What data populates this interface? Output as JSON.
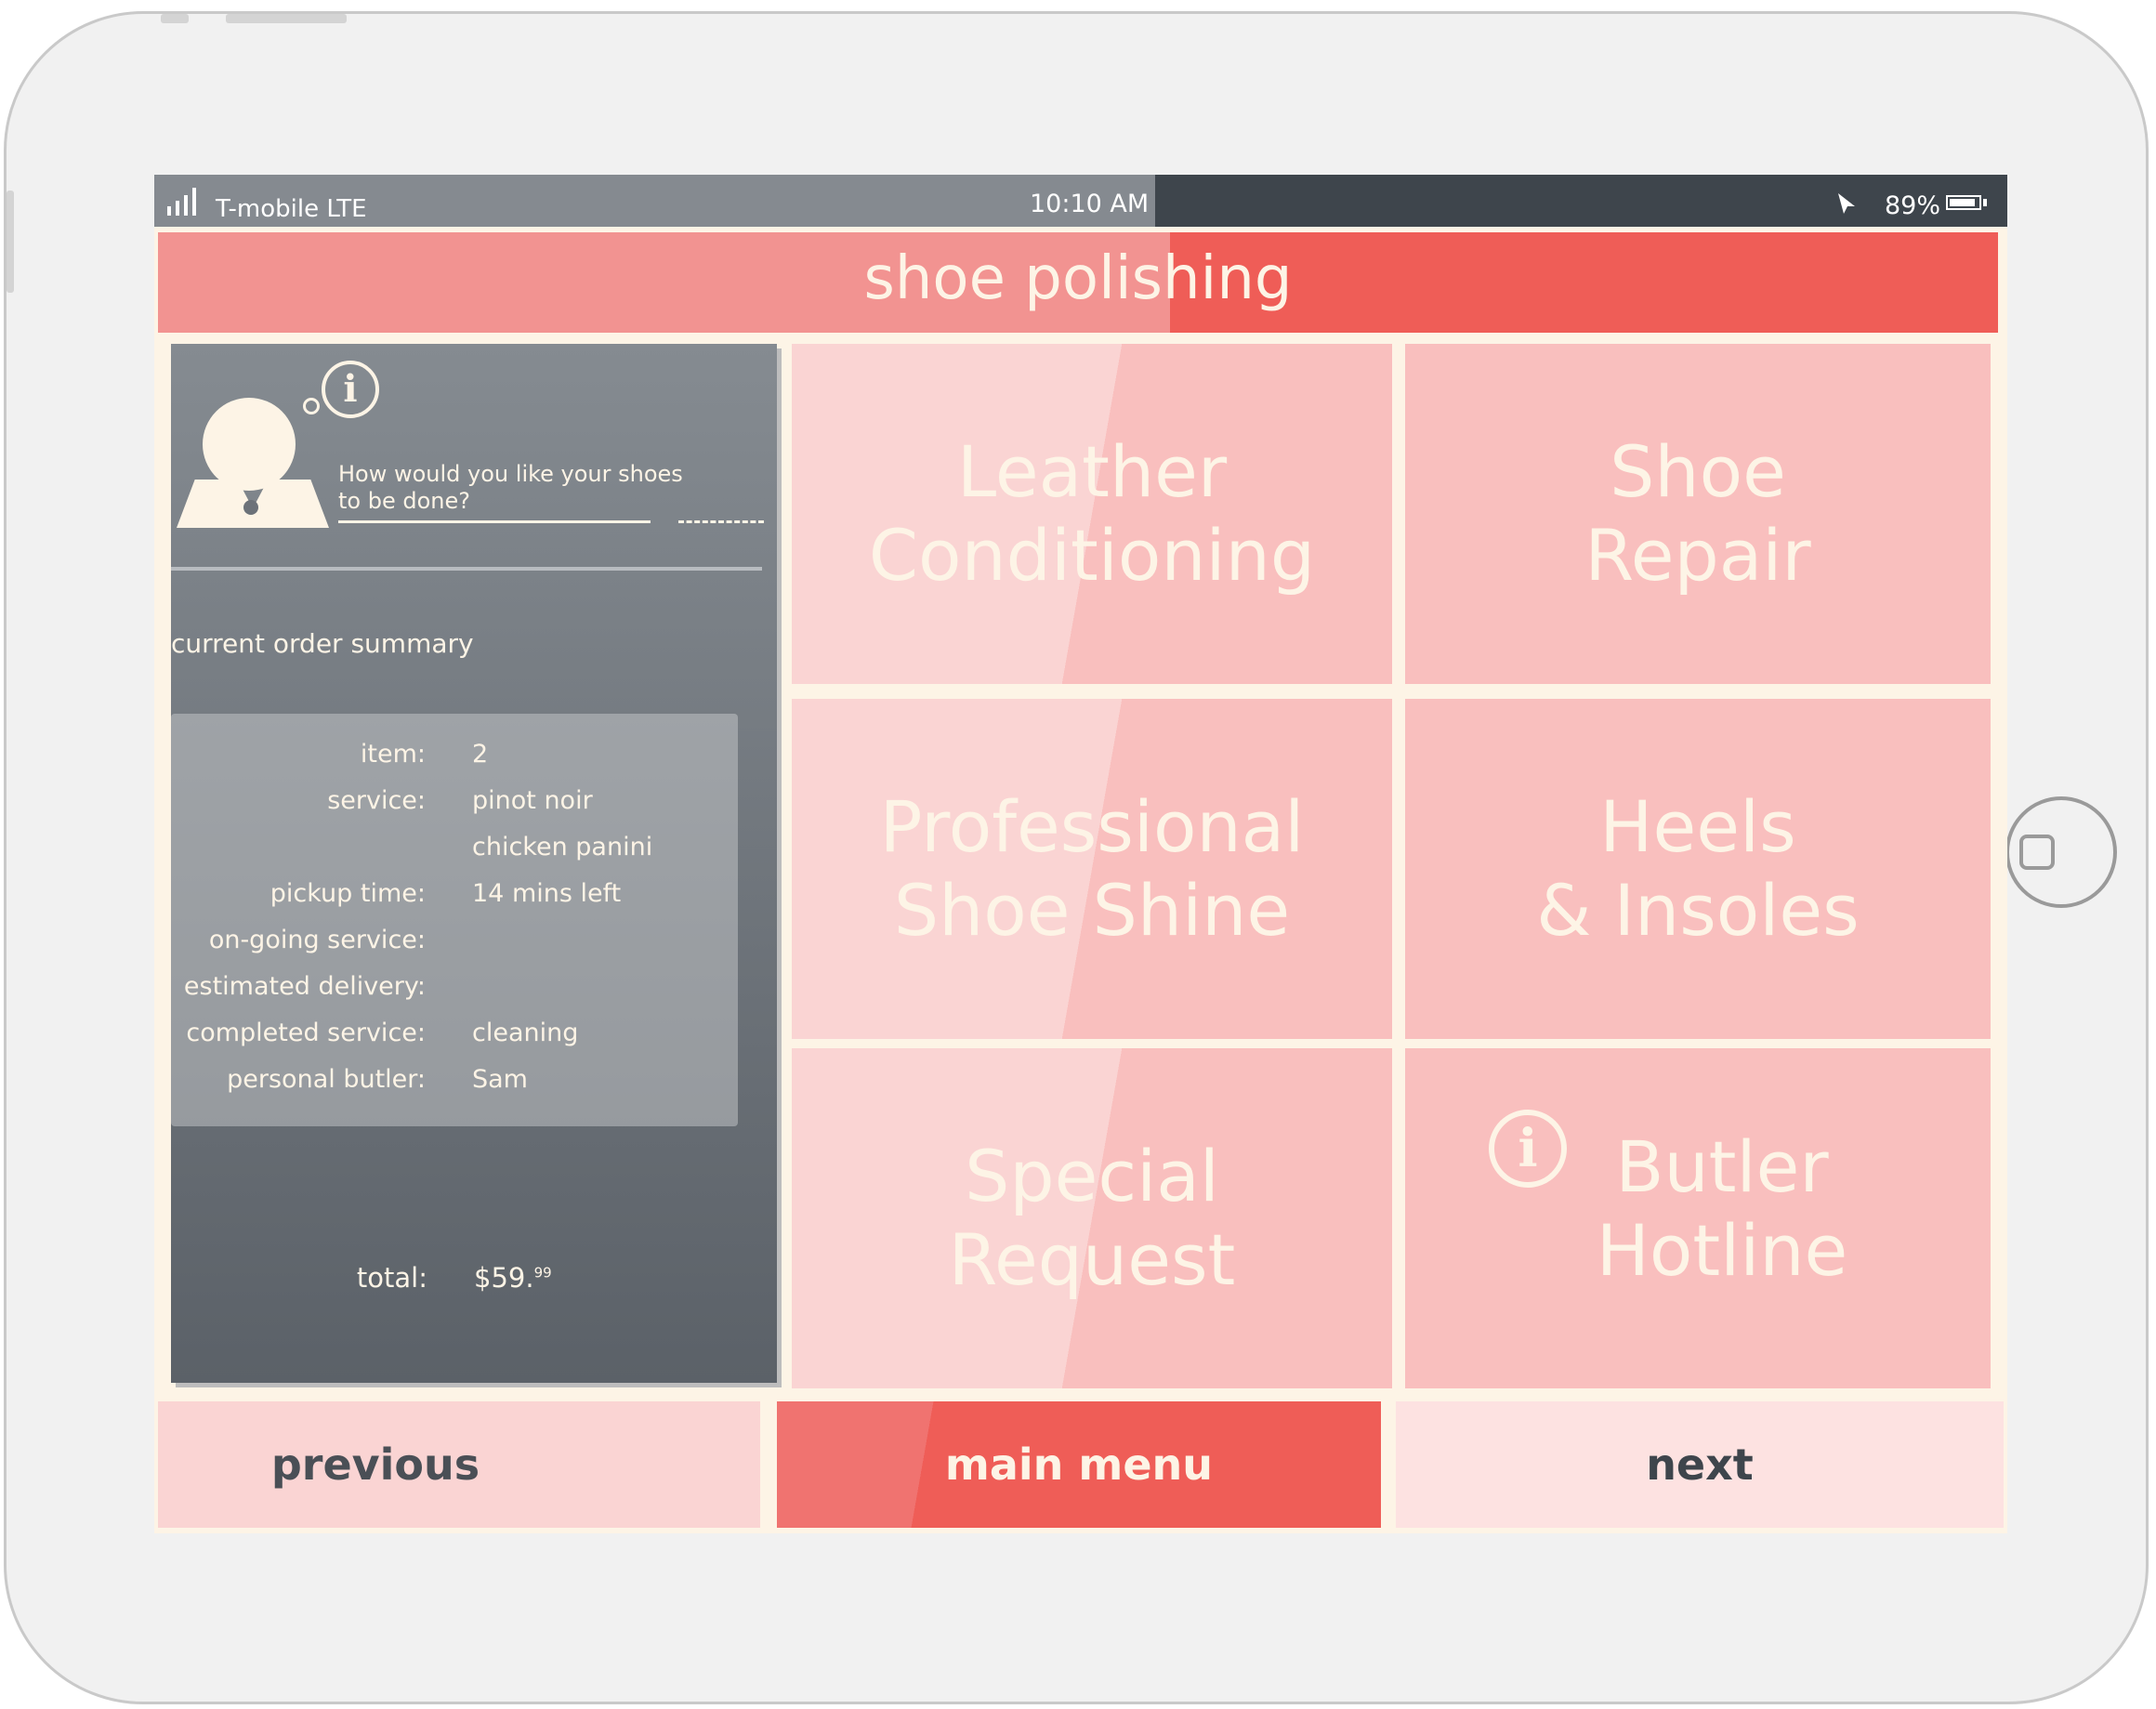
{
  "status_bar": {
    "carrier": "T-mobile LTE",
    "time": "10:10 AM",
    "battery": "89%",
    "battery_level": 0.89
  },
  "header": {
    "title": "shoe polishing"
  },
  "assistant": {
    "question": "How would you like your shoes to be done?",
    "icons": [
      "avatar-icon",
      "info-icon"
    ]
  },
  "summary": {
    "title": "current order summary",
    "rows": [
      {
        "label": "item:",
        "value": "2"
      },
      {
        "label": "service:",
        "value": "pinot noir"
      },
      {
        "label": "",
        "value": "chicken panini"
      },
      {
        "label": "pickup time:",
        "value": "14 mins left"
      },
      {
        "label": "on-going service:",
        "value": ""
      },
      {
        "label": "estimated  delivery:",
        "value": ""
      },
      {
        "label": "completed service:",
        "value": "cleaning"
      },
      {
        "label": "personal butler:",
        "value": "Sam"
      }
    ],
    "total_label": "total:",
    "total_dollars": "$59.",
    "total_cents": "99"
  },
  "tiles": [
    {
      "label": "Leather\nConditioning"
    },
    {
      "label": "Shoe\nRepair"
    },
    {
      "label": "Professional\nShoe Shine"
    },
    {
      "label": "Heels\n& Insoles"
    },
    {
      "label": "Special\nRequest"
    },
    {
      "label": "Butler\nHotline",
      "icon": "info-icon"
    }
  ],
  "nav": {
    "previous": "previous",
    "main_menu": "main menu",
    "next": "next"
  },
  "colors": {
    "coral": "#ef5d57",
    "light_pink": "#fad4d3",
    "mid_pink": "#f9bfbe",
    "cream": "#fdf4e6",
    "slate": "#5b6168"
  }
}
